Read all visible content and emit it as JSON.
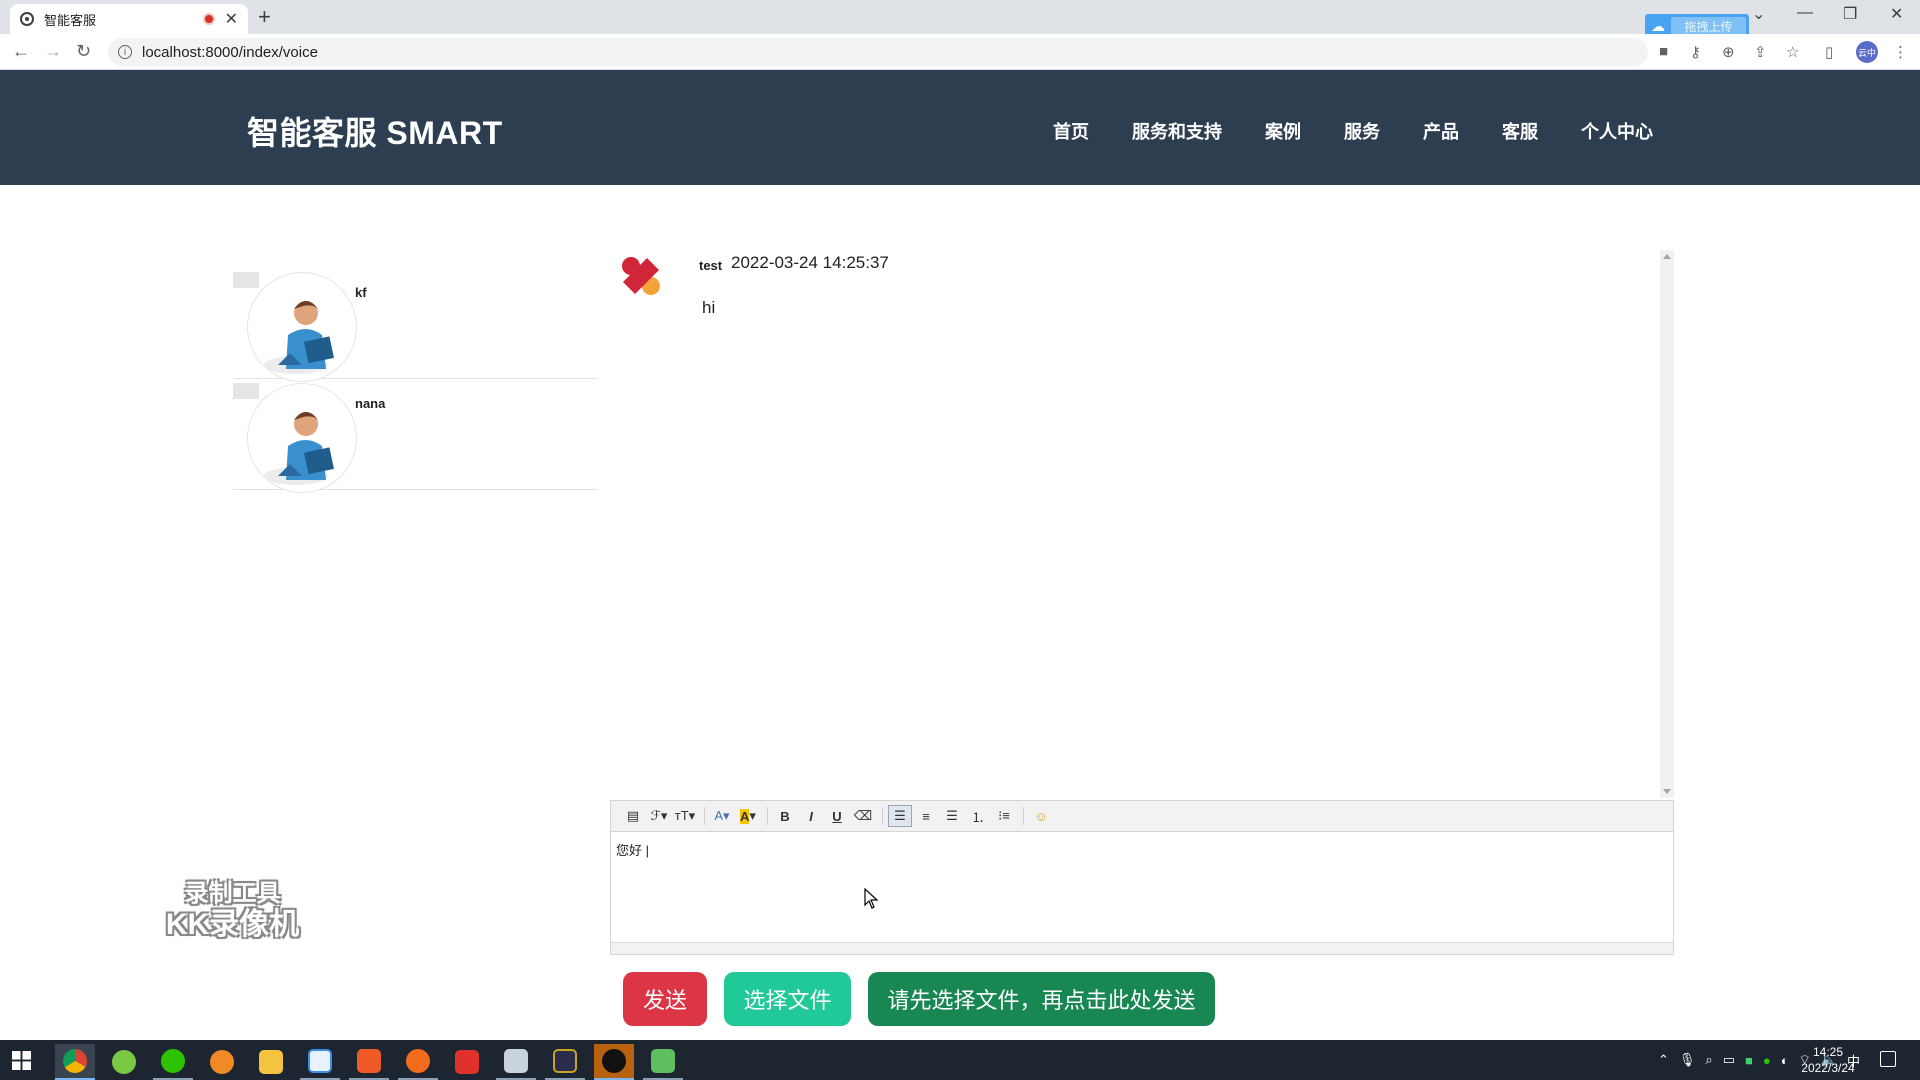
{
  "browser": {
    "tab_title": "智能客服",
    "url": "localhost:8000/index/voice",
    "upload_pill_label": "拖拽上传",
    "profile_label": "云中"
  },
  "site": {
    "brand": "智能客服 SMART",
    "nav": [
      "首页",
      "服务和支持",
      "案例",
      "服务",
      "产品",
      "客服",
      "个人中心"
    ]
  },
  "contacts": [
    {
      "name": "kf"
    },
    {
      "name": "nana"
    }
  ],
  "chat": {
    "messages": [
      {
        "user": "test",
        "time": "2022-03-24 14:25:37",
        "text": "hi"
      }
    ]
  },
  "editor": {
    "content": "您好 |",
    "toolbar": [
      "source-icon",
      "font-family-icon",
      "font-size-icon",
      "font-color-icon",
      "highlight-icon",
      "bold-icon",
      "italic-icon",
      "underline-icon",
      "eraser-icon",
      "align-left-icon",
      "align-center-icon",
      "align-right-icon",
      "ordered-list-icon",
      "bullet-list-icon",
      "emoji-icon"
    ]
  },
  "buttons": {
    "send": "发送",
    "choose_file": "选择文件",
    "upload": "请先选择文件，再点击此处发送"
  },
  "watermark": {
    "line1": "录制工具",
    "line2": "KK录像机"
  },
  "taskbar": {
    "time": "14:25",
    "date": "2022/3/24",
    "ime": "中"
  },
  "colors": {
    "header_bg": "#2c3e50",
    "send_btn": "#dc3545",
    "choose_btn": "#20c997",
    "upload_btn": "#198754"
  }
}
